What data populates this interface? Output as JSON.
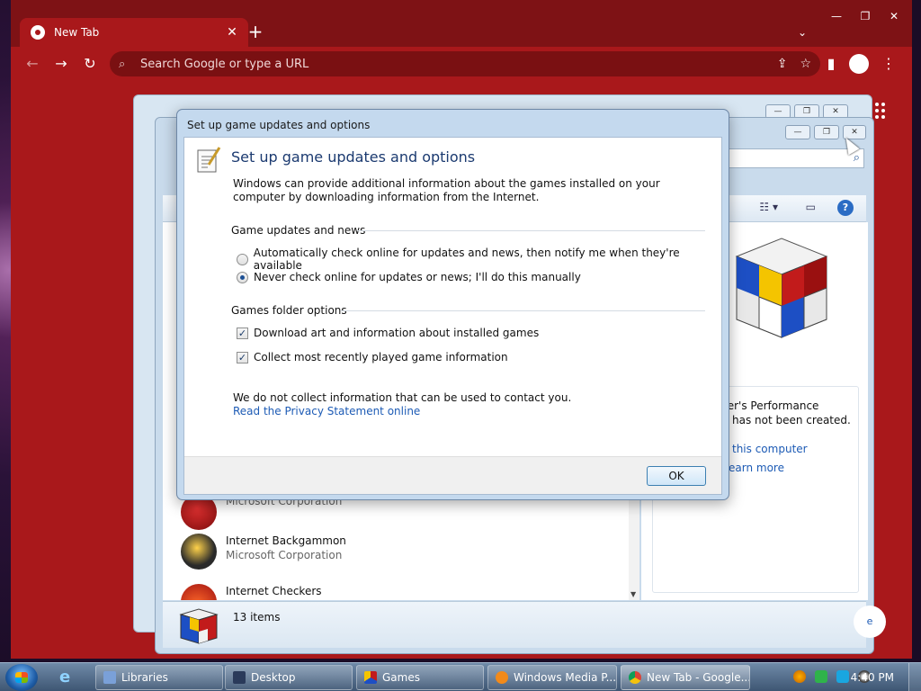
{
  "chrome": {
    "tab_title": "New Tab",
    "omnibox_placeholder": "Search Google or type a URL"
  },
  "dialog": {
    "window_title": "Set up game updates and options",
    "heading": "Set up game updates and options",
    "description": "Windows can provide additional information about the games installed on your computer by downloading information from the Internet.",
    "updates_section": "Game updates and news",
    "radio_auto": "Automatically check online for updates and news, then notify me when they're available",
    "radio_manual": "Never check online for updates or news; I'll do this manually",
    "selected_option": "manual",
    "folder_section": "Games folder options",
    "check_art": "Download art and information about installed games",
    "check_art_checked": true,
    "check_recent": "Collect most recently played game information",
    "check_recent_checked": true,
    "privacy_text": "We do not collect information that can be used to contact you.",
    "privacy_link": "Read the Privacy Statement online",
    "ok_label": "OK"
  },
  "games_window": {
    "rows": [
      {
        "name": "",
        "company": "Microsoft Corporation"
      },
      {
        "name": "Internet Backgammon",
        "company": "Microsoft Corporation"
      },
      {
        "name": "Internet Checkers",
        "company": ""
      }
    ],
    "perf_line1": "ter's Performance",
    "perf_line2": "has not been created.",
    "perf_link1": "this computer",
    "perf_link2": "earn more",
    "status_count": "13 items",
    "round_btn": "e"
  },
  "taskbar": {
    "buttons": [
      {
        "label": "Libraries"
      },
      {
        "label": "Desktop"
      },
      {
        "label": "Games"
      },
      {
        "label": "Windows Media P..."
      },
      {
        "label": "New Tab - Google..."
      }
    ],
    "clock": "4:40 PM"
  },
  "colors": {
    "chrome_theme": "#a9181b",
    "link": "#1d5bb5",
    "dialog_heading": "#1b3a70"
  }
}
